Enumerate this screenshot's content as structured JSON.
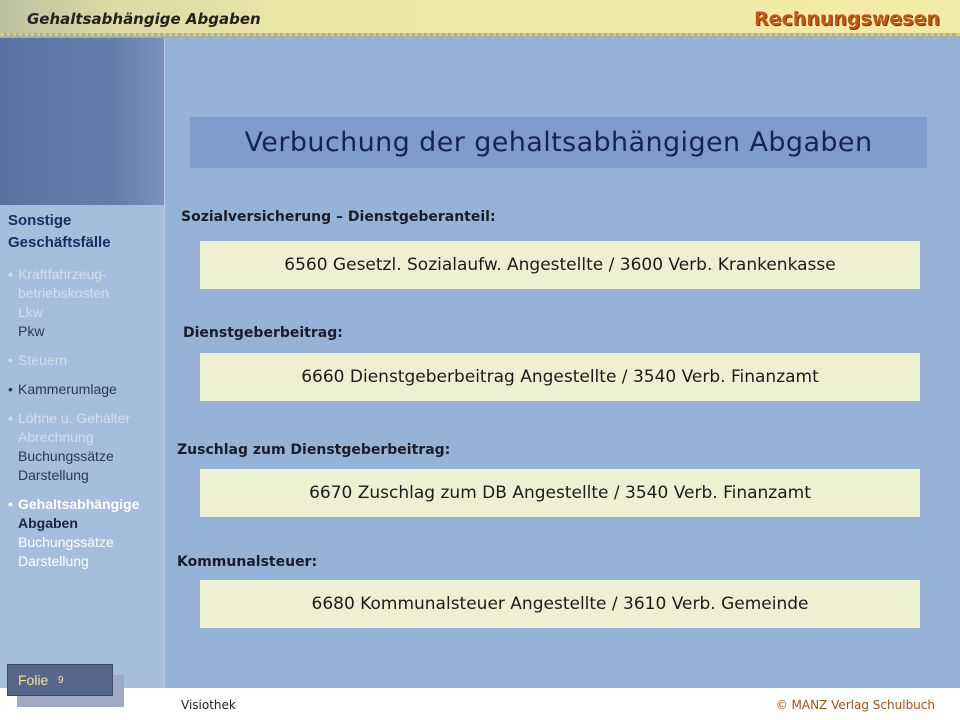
{
  "header": {
    "title": "Gehaltsabhängige Abgaben",
    "brand": "Rechnungswesen"
  },
  "sidebar": {
    "section_title": "Sonstige Geschäftsfälle",
    "items": [
      {
        "lines": [
          "Kraftfahrzeug-",
          "betriebskosten",
          "Lkw",
          "Pkw"
        ]
      },
      {
        "lines": [
          "Steuern"
        ]
      },
      {
        "lines": [
          "Kammerumlage"
        ]
      },
      {
        "lines": [
          "Löhne u. Gehälter",
          "Abrechnung",
          "Buchungssätze",
          "Darstellung"
        ]
      },
      {
        "lines": [
          "Gehaltsabhängige",
          "Abgaben",
          "Buchungssätze",
          "Darstellung"
        ]
      }
    ]
  },
  "main": {
    "title": "Verbuchung der gehaltsabhängigen Abgaben",
    "entries": [
      {
        "heading": "Sozialversicherung – Dienstgeberanteil:",
        "booking": "6560 Gesetzl. Sozialaufw. Angestellte / 3600 Verb. Krankenkasse"
      },
      {
        "heading": "Dienstgeberbeitrag:",
        "booking": "6660 Dienstgeberbeitrag Angestellte / 3540 Verb. Finanzamt"
      },
      {
        "heading": "Zuschlag zum Dienstgeberbeitrag:",
        "booking": "6670 Zuschlag zum DB Angestellte / 3540 Verb. Finanzamt"
      },
      {
        "heading": "Kommunalsteuer:",
        "booking": "6680 Kommunalsteuer Angestellte / 3610 Verb. Gemeinde"
      }
    ]
  },
  "footer": {
    "slide_label": "Folie",
    "slide_number": "9",
    "publisher_left": "Visiothek",
    "publisher_right": "© MANZ Verlag Schulbuch"
  },
  "colors": {
    "brand": "#c2570f",
    "title_box": "#7f9dcc",
    "booking_box": "#eef0d3",
    "main_background": "#97b2d7",
    "sidebar_background": "#a7bddd",
    "active_nav": "#ffffff",
    "footer_credit": "#b24a12"
  }
}
